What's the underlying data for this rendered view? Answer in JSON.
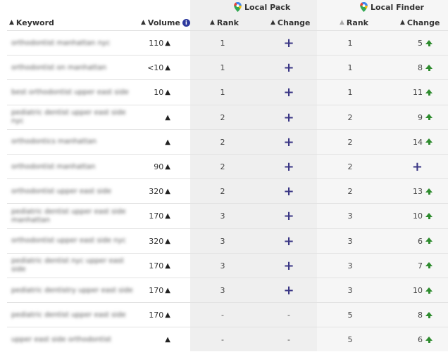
{
  "groups": {
    "local_pack": "Local Pack",
    "local_finder": "Local Finder"
  },
  "headers": {
    "keyword": "Keyword",
    "volume": "Volume",
    "pack_rank": "Rank",
    "pack_change": "Change",
    "finder_rank": "Rank",
    "finder_change": "Change"
  },
  "colors": {
    "plus": "#3b3785",
    "up": "#2e8b2e",
    "info": "#2e3a9e"
  },
  "rows": [
    {
      "keyword": "orthodontist manhattan nyc",
      "volume": "110",
      "pack_rank": "1",
      "pack_change": "+",
      "finder_rank": "1",
      "finder_change": "5",
      "finder_up": true
    },
    {
      "keyword": "orthodontist on manhattan",
      "volume": "<10",
      "pack_rank": "1",
      "pack_change": "+",
      "finder_rank": "1",
      "finder_change": "8",
      "finder_up": true
    },
    {
      "keyword": "best orthodontist upper east side",
      "volume": "10",
      "pack_rank": "1",
      "pack_change": "+",
      "finder_rank": "1",
      "finder_change": "11",
      "finder_up": true
    },
    {
      "keyword": "pediatric dentist upper east side nyc",
      "volume": "",
      "pack_rank": "2",
      "pack_change": "+",
      "finder_rank": "2",
      "finder_change": "9",
      "finder_up": true
    },
    {
      "keyword": "orthodontics manhattan",
      "volume": "",
      "pack_rank": "2",
      "pack_change": "+",
      "finder_rank": "2",
      "finder_change": "14",
      "finder_up": true
    },
    {
      "keyword": "orthodontist manhattan",
      "volume": "90",
      "pack_rank": "2",
      "pack_change": "+",
      "finder_rank": "2",
      "finder_change": "+",
      "finder_up": false
    },
    {
      "keyword": "orthodontist upper east side",
      "volume": "320",
      "pack_rank": "2",
      "pack_change": "+",
      "finder_rank": "2",
      "finder_change": "13",
      "finder_up": true
    },
    {
      "keyword": "pediatric dentist upper east side manhattan",
      "volume": "170",
      "pack_rank": "3",
      "pack_change": "+",
      "finder_rank": "3",
      "finder_change": "10",
      "finder_up": true
    },
    {
      "keyword": "orthodontist upper east side nyc",
      "volume": "320",
      "pack_rank": "3",
      "pack_change": "+",
      "finder_rank": "3",
      "finder_change": "6",
      "finder_up": true
    },
    {
      "keyword": "pediatric dentist nyc upper east side",
      "volume": "170",
      "pack_rank": "3",
      "pack_change": "+",
      "finder_rank": "3",
      "finder_change": "7",
      "finder_up": true
    },
    {
      "keyword": "pediatric dentistry upper east side",
      "volume": "170",
      "pack_rank": "3",
      "pack_change": "+",
      "finder_rank": "3",
      "finder_change": "10",
      "finder_up": true
    },
    {
      "keyword": "pediatric dentist upper east side",
      "volume": "170",
      "pack_rank": "-",
      "pack_change": "-",
      "finder_rank": "5",
      "finder_change": "8",
      "finder_up": true
    },
    {
      "keyword": "upper east side orthodontist",
      "volume": "",
      "pack_rank": "-",
      "pack_change": "-",
      "finder_rank": "5",
      "finder_change": "6",
      "finder_up": true
    }
  ]
}
